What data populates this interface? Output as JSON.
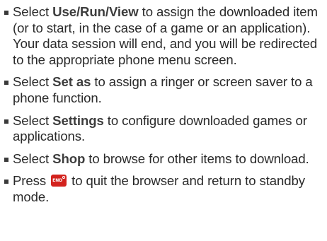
{
  "items": [
    {
      "keyword": "Use/Run/View",
      "before": "Select ",
      "after": " to assign the downloaded item (or to start, in the case of a game or an application). Your data session will end, and you will be redirected to the appropriate phone menu screen."
    },
    {
      "keyword": "Set as",
      "before": "Select ",
      "after": " to assign a ringer or screen saver to a phone function."
    },
    {
      "keyword": "Settings",
      "before": "Select ",
      "after": " to configure downloaded games or applications."
    },
    {
      "keyword": "Shop",
      "before": "Select ",
      "after": " to browse for other items to download."
    },
    {
      "before": "Press ",
      "key_label": "END",
      "key_icon": "end-power-key-icon",
      "after": " to quit the browser and return to standby mode."
    }
  ],
  "colors": {
    "text": "#2a2a2a",
    "keyword": "#3d3d3d",
    "end_key": "#d3231e"
  }
}
